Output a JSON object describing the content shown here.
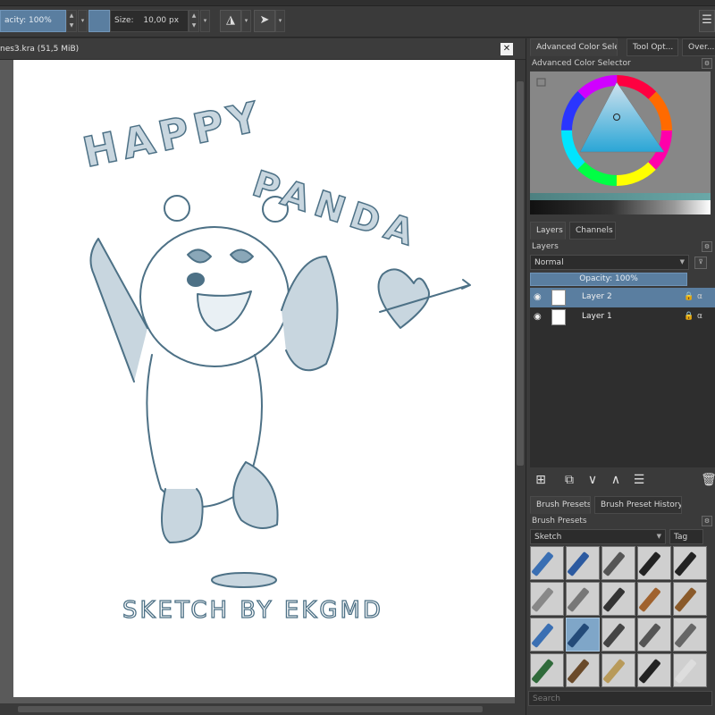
{
  "toolbar": {
    "opacity_text": "acity: 100%",
    "size_label": "Size:",
    "size_value": "10,00 px"
  },
  "document": {
    "tab_title": "nes3.kra (51,5 MiB)"
  },
  "artwork": {
    "title_line1": "HAPPY",
    "title_line2": "PANDA",
    "signature": "SKETCH BY EKGMD"
  },
  "dock": {
    "top_tabs": [
      "Advanced Color Sele...",
      "Tool Opt...",
      "Over..."
    ],
    "color_selector_title": "Advanced Color Selector",
    "layers_tabs": [
      "Layers",
      "Channels"
    ],
    "layers_title": "Layers",
    "blend_mode": "Normal",
    "opacity": "Opacity:  100%",
    "layers": [
      {
        "name": "Layer 2",
        "selected": true
      },
      {
        "name": "Layer 1",
        "selected": false
      }
    ],
    "brush_tabs": [
      "Brush Presets",
      "Brush Preset History"
    ],
    "brush_title": "Brush Presets",
    "brush_filter": "Sketch",
    "tag_label": "Tag",
    "search_placeholder": "Search"
  },
  "colors": {
    "accent": "#5a7ea0",
    "sketch_ink": "#4d7186",
    "panel_bg": "#3a3a3a"
  }
}
